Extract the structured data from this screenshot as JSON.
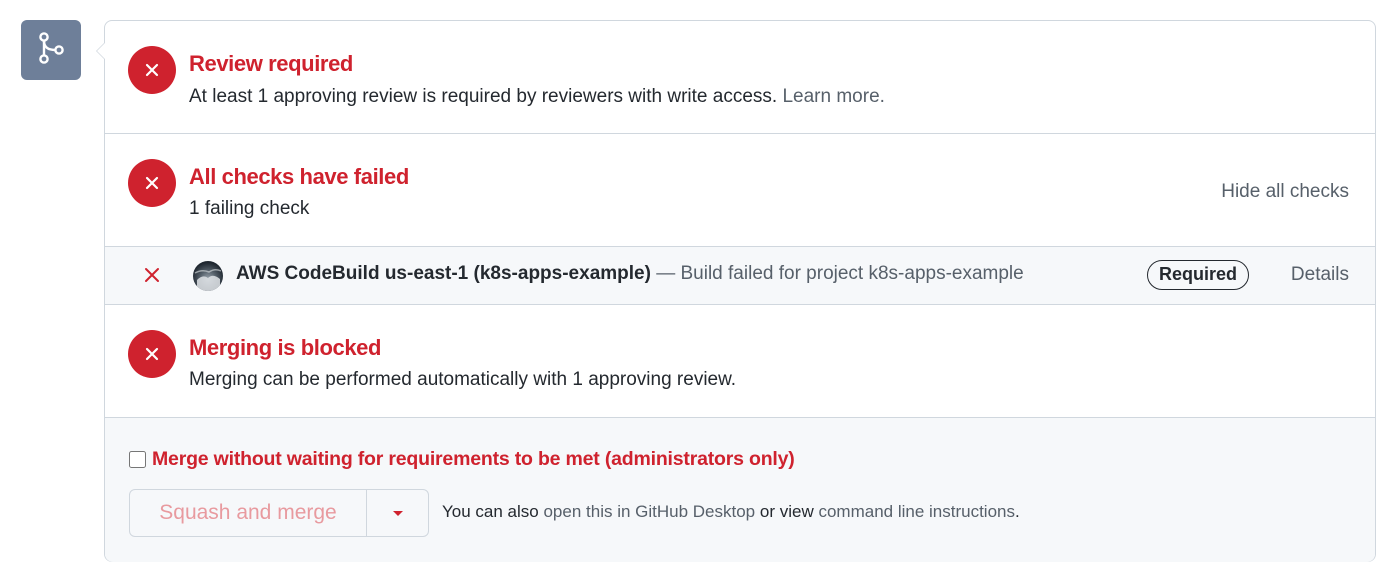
{
  "icons": {
    "merge": "git-merge-icon",
    "status_fail": "x-circle-icon",
    "check_fail": "x-icon",
    "avatar": "aws-codebuild-avatar",
    "dropdown": "triangle-down-icon"
  },
  "colors": {
    "danger": "#cf222e",
    "muted": "#57606a",
    "text": "#24292f",
    "border": "#d0d7de",
    "merge_icon_bg": "#6e7f99",
    "subtle_bg": "#f6f8fa"
  },
  "review": {
    "title": "Review required",
    "description": "At least 1 approving review is required by reviewers with write access.",
    "learn_more": "Learn more."
  },
  "checks": {
    "title": "All checks have failed",
    "subtitle": "1 failing check",
    "hide_label": "Hide all checks",
    "items": [
      {
        "name": "AWS CodeBuild us-east-1 (k8s-apps-example)",
        "separator": "—",
        "message": "Build failed for project k8s-apps-example",
        "badge": "Required",
        "details": "Details"
      }
    ]
  },
  "merging": {
    "title": "Merging is blocked",
    "description": "Merging can be performed automatically with 1 approving review."
  },
  "footer": {
    "admin_checkbox_label": "Merge without waiting for requirements to be met (administrators only)",
    "admin_checked": false,
    "merge_button": "Squash and merge",
    "alt_prefix": "You can also",
    "alt_desktop_link": "open this in GitHub Desktop",
    "alt_middle": "or view",
    "alt_cli_link": "command line instructions",
    "alt_suffix": "."
  }
}
